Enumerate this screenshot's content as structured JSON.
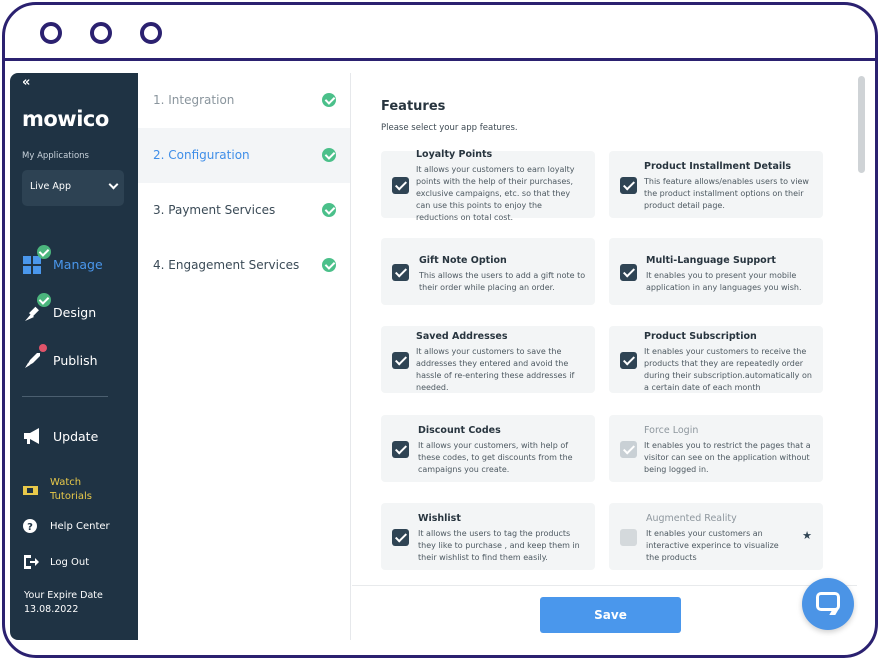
{
  "window": {
    "controls": [
      "circle",
      "circle",
      "circle"
    ]
  },
  "sidebar": {
    "collapse_label": "«",
    "logo_text": "mowico",
    "my_applications_label": "My Applications",
    "app_select_value": "Live App",
    "nav": [
      {
        "label": "Manage",
        "icon": "grid-icon",
        "badge": "check"
      },
      {
        "label": "Design",
        "icon": "brush-icon",
        "badge": "check"
      },
      {
        "label": "Publish",
        "icon": "rocket-icon",
        "badge": "dot"
      },
      {
        "label": "Update",
        "icon": "megaphone-icon"
      }
    ],
    "links": [
      {
        "label": "Watch Tutorials",
        "icon": "ticket-icon"
      },
      {
        "label": "Help Center",
        "icon": "question-icon"
      },
      {
        "label": "Log Out",
        "icon": "logout-icon"
      }
    ],
    "expire_label": "Your Expire Date",
    "expire_date": "13.08.2022"
  },
  "steps": [
    {
      "label": "1. Integration"
    },
    {
      "label": "2. Configuration"
    },
    {
      "label": "3. Payment Services"
    },
    {
      "label": "4. Engagement Services"
    }
  ],
  "main": {
    "title": "Features",
    "subtitle": "Please select your app features.",
    "features": [
      {
        "title": "Loyalty Points",
        "desc": "It allows your customers to earn loyalty points with the help of their purchases, exclusive campaigns, etc. so that they can use this points to enjoy the reductions on total cost.",
        "checked": true
      },
      {
        "title": "Product Installment Details",
        "desc": "This feature allows/enables users to view the product installment options on their product detail page.",
        "checked": true
      },
      {
        "title": "Gift Note Option",
        "desc": "This allows the users to add a gift note to their order while placing an order.",
        "checked": true
      },
      {
        "title": "Multi-Language Support",
        "desc": "It enables you to present your mobile application in any languages you wish.",
        "checked": true
      },
      {
        "title": "Saved Addresses",
        "desc": "It allows your customers to save the addresses they entered and avoid the hassle of re-entering these addresses if needed.",
        "checked": true
      },
      {
        "title": "Product Subscription",
        "desc": "It enables your customers to receive the products that they are repeatedly order during their subscription.automatically on a certain date of each month",
        "checked": true
      },
      {
        "title": "Discount Codes",
        "desc": "It allows your customers, with help of these codes, to get discounts from the campaigns you create.",
        "checked": true
      },
      {
        "title": "Force Login",
        "desc": "It enables you to restrict the pages that a visitor can see on the application without being logged in.",
        "checked": true,
        "disabled": true
      },
      {
        "title": "Wishlist",
        "desc": "It allows the users to tag the products they like to purchase , and keep them in their wishlist to find them easily.",
        "checked": true
      },
      {
        "title": "Augmented Reality",
        "desc": "It enables your customers an interactive experince to visualize the products",
        "checked": false,
        "disabled": true,
        "premium": true
      }
    ],
    "save_label": "Save"
  },
  "colors": {
    "sidebar": "#1f3344",
    "accent": "#4a97ec",
    "success": "#4bc08a",
    "frame": "#2b2170"
  }
}
